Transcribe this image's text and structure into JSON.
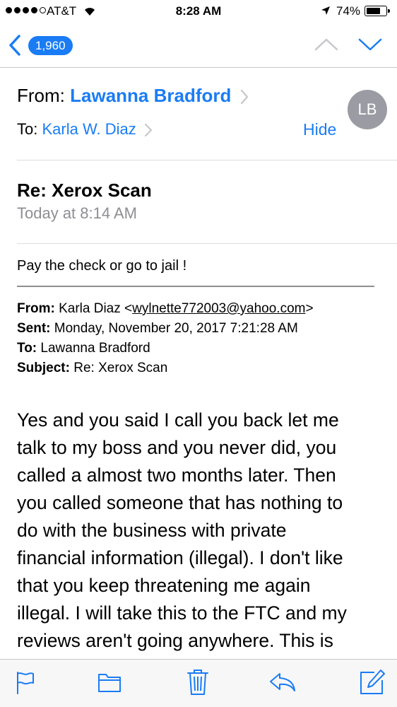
{
  "status_bar": {
    "carrier": "AT&T",
    "time": "8:28 AM",
    "battery_percent": "74%",
    "battery_level": 0.74,
    "signal_bars": 4,
    "signal_total": 5
  },
  "nav": {
    "message_count": "1,960"
  },
  "header": {
    "from_label": "From:",
    "from_name": "Lawanna Bradford",
    "to_label": "To:",
    "to_name": "Karla W. Diaz",
    "hide_label": "Hide",
    "avatar_initials": "LB",
    "subject": "Re: Xerox Scan",
    "date": "Today at 8:14 AM"
  },
  "body": {
    "intro": "Pay the check or go to jail !",
    "quoted": {
      "from_label": "From:",
      "from_name": "Karla Diaz <",
      "from_email": "wylnette772003@yahoo.com",
      "from_close": ">",
      "sent_label": "Sent:",
      "sent_value": "Monday, November 20, 2017 7:21:28 AM",
      "to_label": "To:",
      "to_value": "Lawanna Bradford",
      "subject_label": "Subject:",
      "subject_value": "Re: Xerox Scan"
    },
    "message_lines": [
      "Yes and you said I call you back let me",
      "talk to my boss and you never did, you",
      "called a almost two months later. Then",
      "you called someone that has nothing to",
      "do with the business with private",
      "financial information (illegal). I don't like",
      "that you keep threatening me again",
      "illegal. I will take this to the FTC and my",
      "reviews aren't going anywhere. This is"
    ]
  },
  "colors": {
    "accent": "#1a7cf4",
    "avatar_bg": "#9b9ba4",
    "secondary_text": "#8e8e93"
  },
  "toolbar": {
    "icons": [
      "flag-icon",
      "folder-icon",
      "trash-icon",
      "reply-icon",
      "compose-icon"
    ]
  }
}
